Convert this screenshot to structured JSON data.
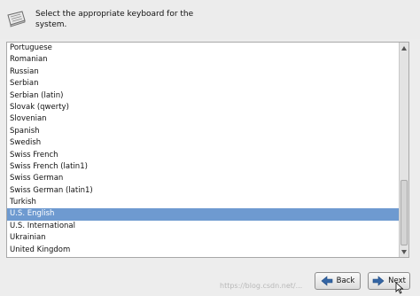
{
  "header": {
    "icon": "keyboard-icon",
    "prompt": "Select the appropriate keyboard for the system."
  },
  "keyboard_list": {
    "items": [
      "Portuguese",
      "Romanian",
      "Russian",
      "Serbian",
      "Serbian (latin)",
      "Slovak (qwerty)",
      "Slovenian",
      "Spanish",
      "Swedish",
      "Swiss French",
      "Swiss French (latin1)",
      "Swiss German",
      "Swiss German (latin1)",
      "Turkish",
      "U.S. English",
      "U.S. International",
      "Ukrainian",
      "United Kingdom"
    ],
    "selected": "U.S. English",
    "selection_color": "#6e9ad0"
  },
  "buttons": {
    "back_label": "Back",
    "back_icon": "left-arrow-icon",
    "next_label": "Next",
    "next_icon": "right-arrow-icon",
    "arrow_color": "#3465a4"
  },
  "watermark": "https://blog.csdn.net/..."
}
